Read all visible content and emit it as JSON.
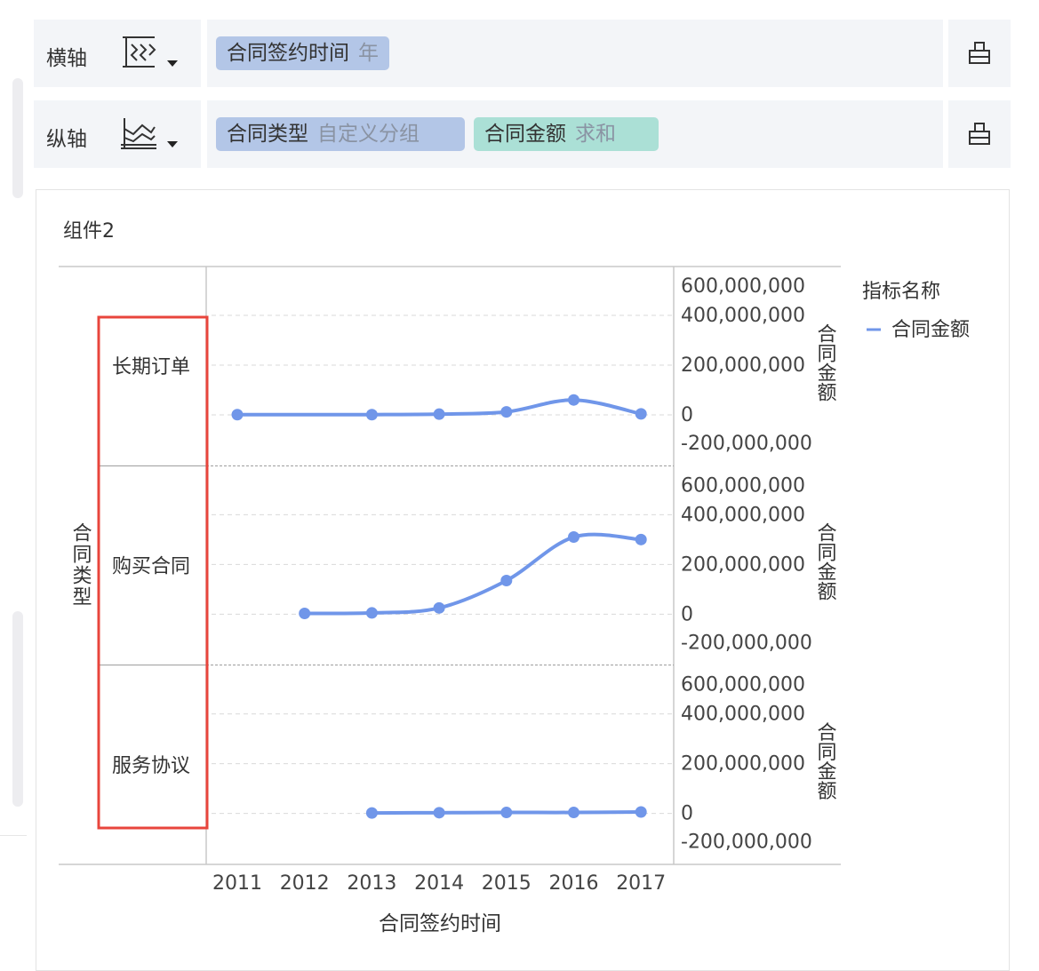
{
  "x_shelf": {
    "label": "横轴",
    "field": "合同签约时间",
    "agg": "年"
  },
  "y_shelf": {
    "label": "纵轴",
    "fields": [
      {
        "field": "合同类型",
        "agg": "自定义分组"
      },
      {
        "field": "合同金额",
        "agg": "求和"
      }
    ]
  },
  "component_title": "组件2",
  "colors": {
    "line": "#7096e9",
    "highlight": "#e8453c",
    "dim_pill": "#b3c6e7",
    "measure_pill": "#abe0d6"
  },
  "chart_data": {
    "type": "line",
    "title": "",
    "xlabel": "合同签约时间",
    "row_label": "合同类型",
    "ylabel": "合同金额",
    "categories": [
      "2011",
      "2012",
      "2013",
      "2014",
      "2015",
      "2016",
      "2017"
    ],
    "y_ticks": [
      "600,000,000",
      "400,000,000",
      "200,000,000",
      "0",
      "-200,000,000"
    ],
    "ylim": [
      -200000000,
      600000000
    ],
    "grid": "dashed horizontal",
    "legend": {
      "title": "指标名称",
      "position": "top-right",
      "items": [
        "合同金额"
      ]
    },
    "panels": [
      {
        "label": "长期订单",
        "values": [
          1000000,
          null,
          1000000,
          3000000,
          12000000,
          60000000,
          4000000
        ]
      },
      {
        "label": "购买合同",
        "values": [
          null,
          3000000,
          5000000,
          25000000,
          135000000,
          310000000,
          300000000
        ]
      },
      {
        "label": "服务协议",
        "values": [
          null,
          null,
          2000000,
          3000000,
          4000000,
          4000000,
          6000000
        ]
      }
    ]
  }
}
